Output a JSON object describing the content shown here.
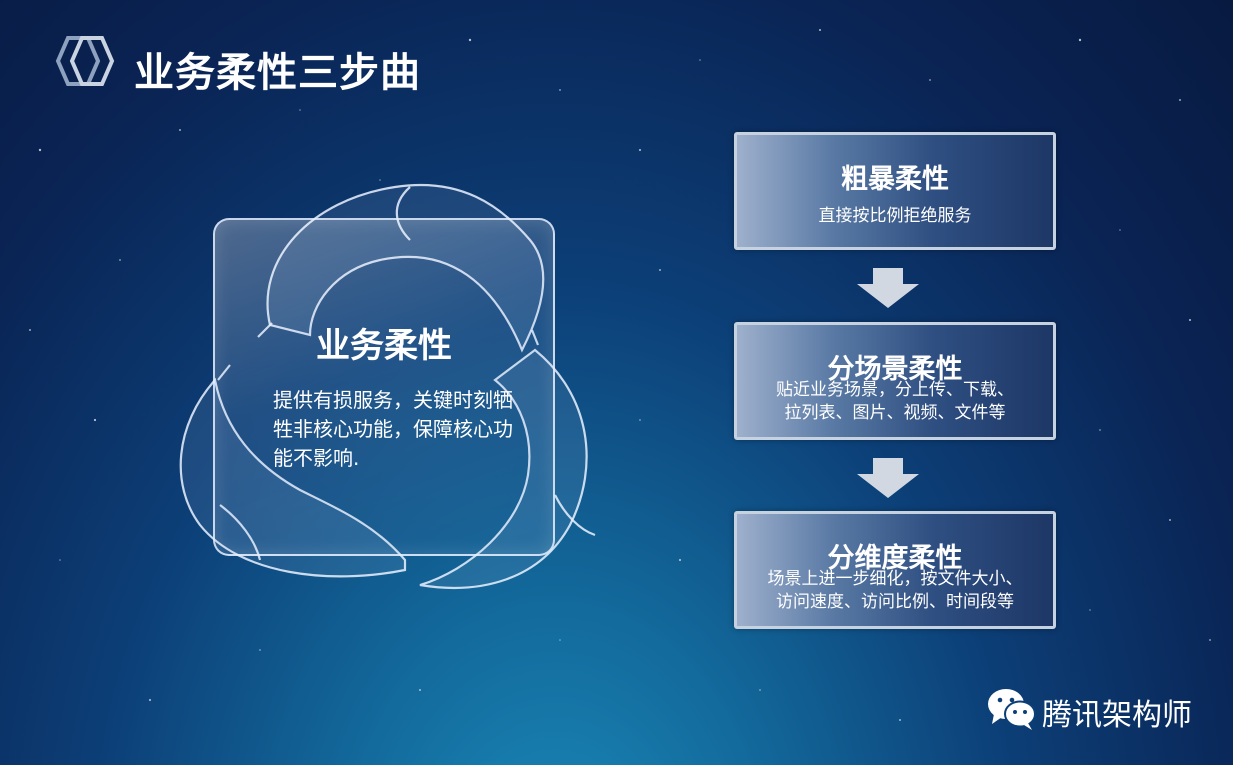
{
  "page": {
    "title": "业务柔性三步曲"
  },
  "center": {
    "title": "业务柔性",
    "description": "提供有损服务，关键时刻牺牲非核心功能，保障核心功能不影响."
  },
  "steps": [
    {
      "title": "粗暴柔性",
      "description": "直接按比例拒绝服务"
    },
    {
      "title": "分场景柔性",
      "description_lines": [
        "贴近业务场景，分上传、下载、",
        "拉列表、图片、视频、文件等"
      ]
    },
    {
      "title": "分维度柔性",
      "description_lines": [
        "场景上进一步细化，按文件大小、",
        "访问速度、访问比例、时间段等"
      ]
    }
  ],
  "brand": {
    "name": "腾讯架构师"
  },
  "icons": {
    "logo": "hexagon-logo-icon",
    "arrow": "arrow-down-icon",
    "brand": "wechat-icon"
  },
  "colors": {
    "background": "#0c3f77",
    "card_border": "#c6d2e0",
    "arrow": "#d2d8e2",
    "text": "#ffffff"
  }
}
